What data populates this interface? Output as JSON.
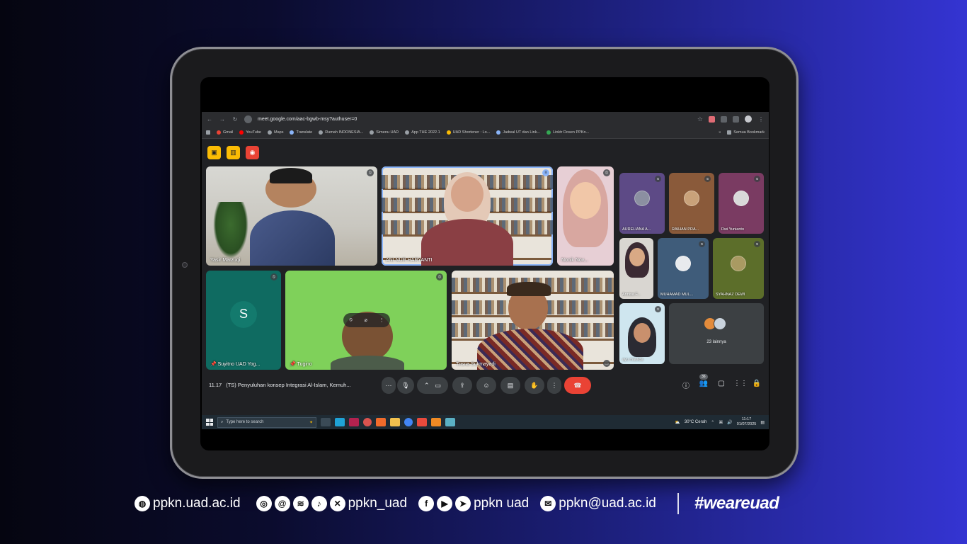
{
  "browser": {
    "url": "meet.google.com/aac-bgwb-msy?authuser=0",
    "bookmarks": [
      "Gmail",
      "YouTube",
      "Maps",
      "Translate",
      "Rumah INDONESIA...",
      "Simenu UAD",
      "App THE 2022.1",
      "UAD Shortener : Lo...",
      "Jadwal UT dan Link...",
      "Linktr Dosen PPKn..."
    ],
    "all_bookmarks": "Semua Bookmark",
    "chevrons": "»"
  },
  "participants": {
    "yasir": "Yasir Marzuqi",
    "ani": "ANI NUR HARYANTI",
    "nonik": "Nonik Nov...",
    "suyitno": "Suyitno UAD Yog...",
    "suyitno_initial": "S",
    "tugino": "Tugino",
    "trisna": "Trisna Sukmayadi",
    "aureliana": "AURELIANA A...",
    "raihan": "RAIHAN PRA...",
    "dwi": "Dwi Yunianto",
    "annisa": "Annisa F...",
    "muhamad": "MUHAMAD MUL...",
    "syahnaz": "SYAHNAZ DEWI",
    "ayu": "ayu maulida",
    "others": "23 lainnya"
  },
  "controls": {
    "time": "11.17",
    "meeting_title": "(TS) Penyuluhan konsep Integrasi Al-Islam, Kemuh...",
    "people_count": "36"
  },
  "taskbar": {
    "search_placeholder": "Type here to search",
    "weather": "30°C  Cerah",
    "time": "11:17",
    "date": "01/07/2025"
  },
  "footer": {
    "website": "ppkn.uad.ac.id",
    "social_handle": "ppkn_uad",
    "social_name": "ppkn uad",
    "email": "ppkn@uad.ac.id",
    "hashtag": "#weareuad"
  },
  "colors": {
    "end_call": "#ea4335",
    "indicator_yellow": "#fbbc04",
    "meet_bg": "#202124"
  }
}
